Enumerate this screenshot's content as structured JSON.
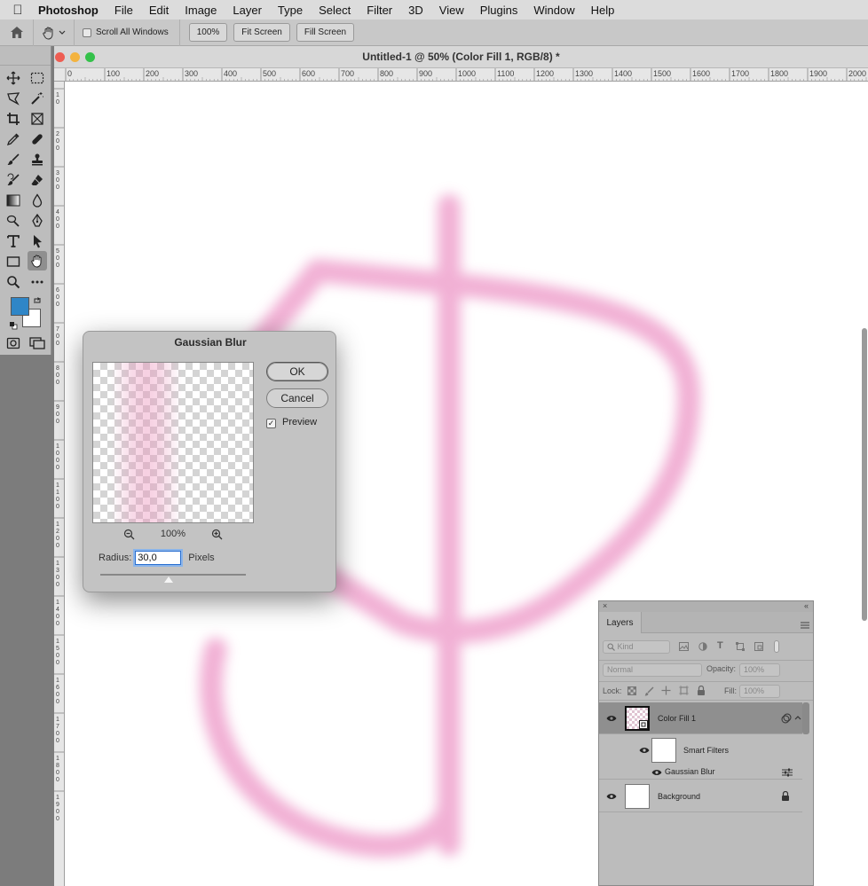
{
  "menubar": {
    "app_name": "Photoshop",
    "items": [
      "File",
      "Edit",
      "Image",
      "Layer",
      "Type",
      "Select",
      "Filter",
      "3D",
      "View",
      "Plugins",
      "Window",
      "Help"
    ]
  },
  "options_bar": {
    "scroll_all_windows": "Scroll All Windows",
    "btn_100": "100%",
    "btn_fit_screen": "Fit Screen",
    "btn_fill_screen": "Fill Screen"
  },
  "document": {
    "title": "Untitled-1 @ 50% (Color Fill 1, RGB/8) *",
    "ruler_top_labels": [
      "0",
      "100",
      "200",
      "300",
      "400",
      "500",
      "600",
      "700",
      "800",
      "900",
      "1000",
      "1100",
      "1200",
      "1300",
      "1400",
      "1500",
      "1600",
      "1700",
      "1800",
      "1900",
      "2000"
    ],
    "ruler_left_labels": [
      "1\n0",
      "2\n0\n0",
      "3\n0\n0",
      "4\n0\n0",
      "5\n0\n0",
      "6\n0\n0",
      "7\n0\n0",
      "8\n0\n0",
      "9\n0\n0",
      "1\n0\n0\n0",
      "1\n1\n0\n0",
      "1\n2\n0\n0",
      "1\n3\n0\n0",
      "1\n4\n0\n0",
      "1\n5\n0\n0",
      "1\n6\n0\n0",
      "1\n7\n0\n0",
      "1\n8\n0\n0",
      "1\n9\n0\n0"
    ],
    "stroke_color": "#f0a8d0"
  },
  "tools": {
    "foreground_color": "#2f86c7",
    "background_color": "#ffffff"
  },
  "gaussian_blur": {
    "title": "Gaussian Blur",
    "ok_label": "OK",
    "cancel_label": "Cancel",
    "preview_label": "Preview",
    "preview_checked": true,
    "zoom_level": "100%",
    "radius_label": "Radius:",
    "radius_value": "30,0",
    "radius_unit": "Pixels"
  },
  "layers_panel": {
    "tab_label": "Layers",
    "filter_kind": "Kind",
    "blend_mode": "Normal",
    "opacity_label": "Opacity:",
    "opacity_value": "100%",
    "lock_label": "Lock:",
    "fill_label": "Fill:",
    "fill_value": "100%",
    "layers": [
      {
        "name": "Color Fill 1"
      },
      {
        "name": "Smart Filters"
      },
      {
        "name": "Gaussian Blur"
      },
      {
        "name": "Background"
      }
    ]
  }
}
